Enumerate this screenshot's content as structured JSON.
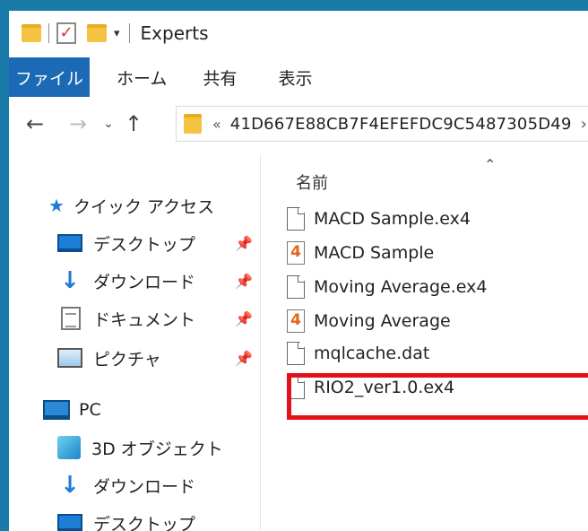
{
  "window": {
    "title": "Experts"
  },
  "ribbon": {
    "tabs": [
      "ファイル",
      "ホーム",
      "共有",
      "表示"
    ]
  },
  "address": {
    "chevrons": "«",
    "path": "41D667E88CB7F4EFEFDC9C5487305D49",
    "next": "›"
  },
  "navpane": {
    "quick_access": "クイック アクセス",
    "items": [
      {
        "label": "デスクトップ",
        "icon": "desktop-icon",
        "pinned": true
      },
      {
        "label": "ダウンロード",
        "icon": "download-icon",
        "pinned": true
      },
      {
        "label": "ドキュメント",
        "icon": "document-icon",
        "pinned": true
      },
      {
        "label": "ピクチャ",
        "icon": "picture-icon",
        "pinned": true
      }
    ],
    "pc": "PC",
    "pc_items": [
      {
        "label": "3D オブジェクト",
        "icon": "3d-objects-icon"
      },
      {
        "label": "ダウンロード",
        "icon": "download-icon"
      },
      {
        "label": "デスクトップ",
        "icon": "desktop-icon"
      }
    ]
  },
  "filelist": {
    "column_name": "名前",
    "files": [
      {
        "name": "MACD Sample.ex4",
        "icon": "blank-file-icon"
      },
      {
        "name": "MACD Sample",
        "icon": "mql4-file-icon"
      },
      {
        "name": "Moving Average.ex4",
        "icon": "blank-file-icon"
      },
      {
        "name": "Moving Average",
        "icon": "mql4-file-icon"
      },
      {
        "name": "mqlcache.dat",
        "icon": "blank-file-icon"
      },
      {
        "name": "RIO2_ver1.0.ex4",
        "icon": "blank-file-icon"
      }
    ],
    "highlight_color": "#e3111b"
  }
}
